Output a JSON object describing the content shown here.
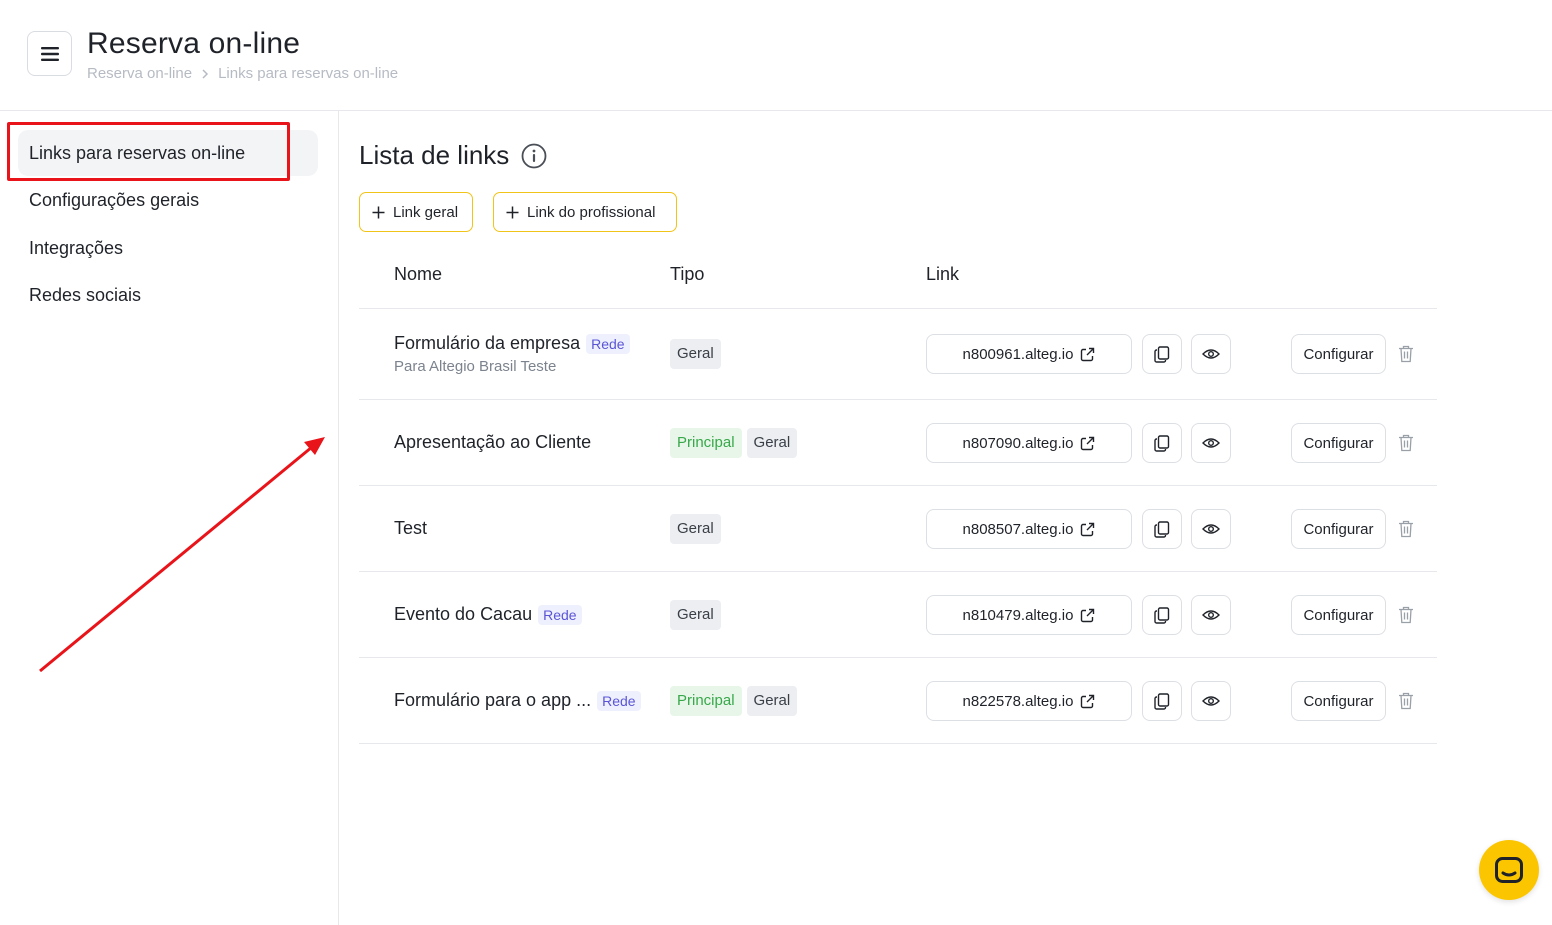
{
  "header": {
    "title": "Reserva on-line",
    "breadcrumb": [
      "Reserva on-line",
      "Links para reservas on-line"
    ]
  },
  "sidebar": {
    "items": [
      {
        "label": "Links para reservas on-line",
        "active": true
      },
      {
        "label": "Configurações gerais",
        "active": false
      },
      {
        "label": "Integrações",
        "active": false
      },
      {
        "label": "Redes sociais",
        "active": false
      }
    ]
  },
  "main": {
    "title": "Lista de links",
    "add_buttons": [
      "Link geral",
      "Link do profissional"
    ],
    "columns": [
      "Nome",
      "Tipo",
      "Link"
    ],
    "configure_label": "Configurar",
    "rows": [
      {
        "name": "Formulário da empresa",
        "badge": "Rede",
        "subtitle": "Para Altegio Brasil Teste",
        "tags": [
          "Geral"
        ],
        "link": "n800961.alteg.io"
      },
      {
        "name": "Apresentação ao Cliente",
        "badge": "",
        "subtitle": "",
        "tags": [
          "Principal",
          "Geral"
        ],
        "link": "n807090.alteg.io"
      },
      {
        "name": "Test",
        "badge": "",
        "subtitle": "",
        "tags": [
          "Geral"
        ],
        "link": "n808507.alteg.io"
      },
      {
        "name": "Evento do Cacau",
        "badge": "Rede",
        "subtitle": "",
        "tags": [
          "Geral"
        ],
        "link": "n810479.alteg.io"
      },
      {
        "name": "Formulário para o app ...",
        "badge": "Rede",
        "subtitle": "",
        "tags": [
          "Principal",
          "Geral"
        ],
        "link": "n822578.alteg.io"
      }
    ]
  },
  "colors": {
    "accent_yellow": "#fbc600",
    "add_button_border": "#f0c419",
    "annotation_red": "#e8141a",
    "badge_rede": "#5b55d6",
    "tag_principal": "#38a84a"
  },
  "icons": [
    "menu-icon",
    "chevron-right-icon",
    "info-icon",
    "plus-icon",
    "external-link-icon",
    "copy-icon",
    "eye-icon",
    "trash-icon",
    "chat-icon"
  ]
}
